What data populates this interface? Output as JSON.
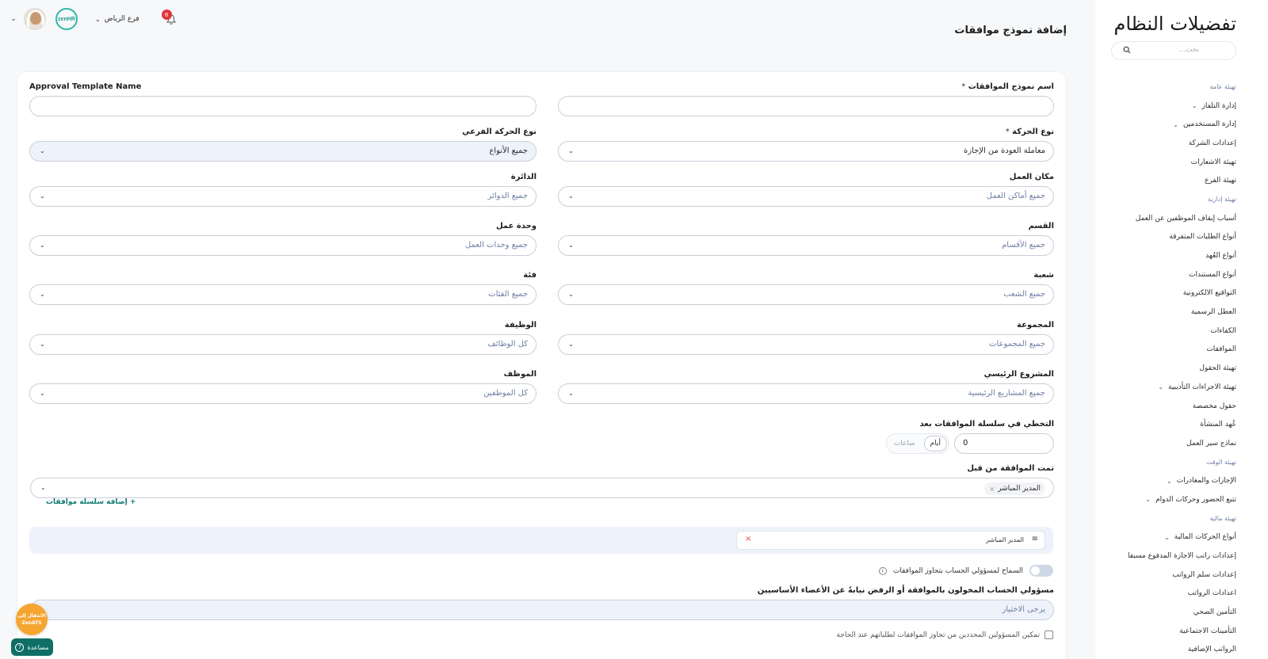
{
  "header": {
    "page_title": "إضافة نموذج موافقات",
    "branch": "فرع الرياض",
    "notification_count": "6",
    "logo_text": "zenHR"
  },
  "sidebar": {
    "title": "تفضيلات النظام",
    "search_placeholder": "بحث...",
    "items": [
      {
        "type": "section",
        "label": "تهيئة عامة"
      },
      {
        "type": "item",
        "label": "إدارة التلفاز",
        "expandable": true
      },
      {
        "type": "item",
        "label": "إدارة المستخدمين",
        "expandable": true
      },
      {
        "type": "item",
        "label": "إعدادات الشركة"
      },
      {
        "type": "item",
        "label": "تهيئة الاشعارات"
      },
      {
        "type": "item",
        "label": "تهيئة الفرع"
      },
      {
        "type": "section",
        "label": "تهيئة إدارية"
      },
      {
        "type": "item",
        "label": "أسباب إيقاف الموظفين عن العمل"
      },
      {
        "type": "item",
        "label": "أنواع الطلبات المتفرقة"
      },
      {
        "type": "item",
        "label": "أنواع العُهد"
      },
      {
        "type": "item",
        "label": "أنواع المستندات"
      },
      {
        "type": "item",
        "label": "التواقيع الالكترونية"
      },
      {
        "type": "item",
        "label": "العطل الرسمية"
      },
      {
        "type": "item",
        "label": "الكفاءات"
      },
      {
        "type": "item",
        "label": "الموافقات"
      },
      {
        "type": "item",
        "label": "تهيئة الحقول"
      },
      {
        "type": "item",
        "label": "تهيئة الاجراءات التأديبية",
        "expandable": true
      },
      {
        "type": "item",
        "label": "حقول مخصصة"
      },
      {
        "type": "item",
        "label": "عُهد المنشأة"
      },
      {
        "type": "item",
        "label": "نماذج سير العمل"
      },
      {
        "type": "section",
        "label": "تهيئة الوقت"
      },
      {
        "type": "item",
        "label": "الإجازات والمغادرات",
        "expandable": true
      },
      {
        "type": "item",
        "label": "تتبع الحضور وحركات الدوام",
        "expandable": true
      },
      {
        "type": "section",
        "label": "تهيئة مالية"
      },
      {
        "type": "item",
        "label": "أنواع الحركات المالية",
        "expandable": true
      },
      {
        "type": "item",
        "label": "إعدادات راتب الاجازة المدفوع مسبقا"
      },
      {
        "type": "item",
        "label": "إعدادات سلم الرواتب"
      },
      {
        "type": "item",
        "label": "اعدادات الرواتب"
      },
      {
        "type": "item",
        "label": "التأمين الصحي"
      },
      {
        "type": "item",
        "label": "التأمينات الاجتماعية"
      },
      {
        "type": "item",
        "label": "الرواتب الإضافية"
      }
    ]
  },
  "form": {
    "name_ar": {
      "label": "اسم نموذج الموافقات",
      "value": ""
    },
    "name_en": {
      "label": "Approval Template Name",
      "value": ""
    },
    "transaction_type": {
      "label": "نوع الحركة",
      "value": "معاملة العودة من الإجازة"
    },
    "sub_type": {
      "label": "نوع الحركة الفرعي",
      "value": "جميع الأنواع"
    },
    "workplace": {
      "label": "مكان العمل",
      "value": "جميع أماكن العمل"
    },
    "department_circle": {
      "label": "الدائرة",
      "value": "جميع الدوائر"
    },
    "section": {
      "label": "القسم",
      "value": "جميع الأقسام"
    },
    "work_unit": {
      "label": "وحدة عمل",
      "value": "جميع وحدات العمل"
    },
    "division": {
      "label": "شعبة",
      "value": "جميع الشعب"
    },
    "category": {
      "label": "فئة",
      "value": "جميع الفئات"
    },
    "group": {
      "label": "المجموعة",
      "value": "جميع المجموعات"
    },
    "job": {
      "label": "الوظيفة",
      "value": "كل الوظائف"
    },
    "main_project": {
      "label": "المشروع الرئيسي",
      "value": "جميع المشاريع الرئيسية"
    },
    "employee": {
      "label": "الموظف",
      "value": "كل الموظفين"
    },
    "skip_after": {
      "label": "التخطي في سلسلة الموافقات بعد",
      "value": "0",
      "unit_days": "أيام",
      "unit_hours": "ساعات",
      "selected_unit": "أيام"
    },
    "approved_by": {
      "label": "تمت الموافقة من قبل",
      "chip": "المدير المباشر"
    },
    "add_chain": "+ إضافة سلسلة موافقات",
    "chain_item": "المدير المباشر",
    "allow_override": {
      "label": "السماح لمسؤولي الحساب بتجاوز الموافقات",
      "enabled": false
    },
    "authorized_admins": {
      "label": "مسؤولي الحساب المخولون بالموافقة أو الرفض نيابةً عن الأعضاء الأساسيين",
      "placeholder": "يرجى الاختيار"
    },
    "enable_override_checkbox": "تمكين المسؤولين المحددين من تجاوز الموافقات لطلباتهم عند الحاجة"
  },
  "floating": {
    "zenats_line1": "الانتقال إلى",
    "zenats_line2": "ZenATS",
    "help": "مساعدة"
  },
  "colors": {
    "accent": "#0f7a72",
    "badge": "#e0343d",
    "zenats": "#f6a531"
  }
}
